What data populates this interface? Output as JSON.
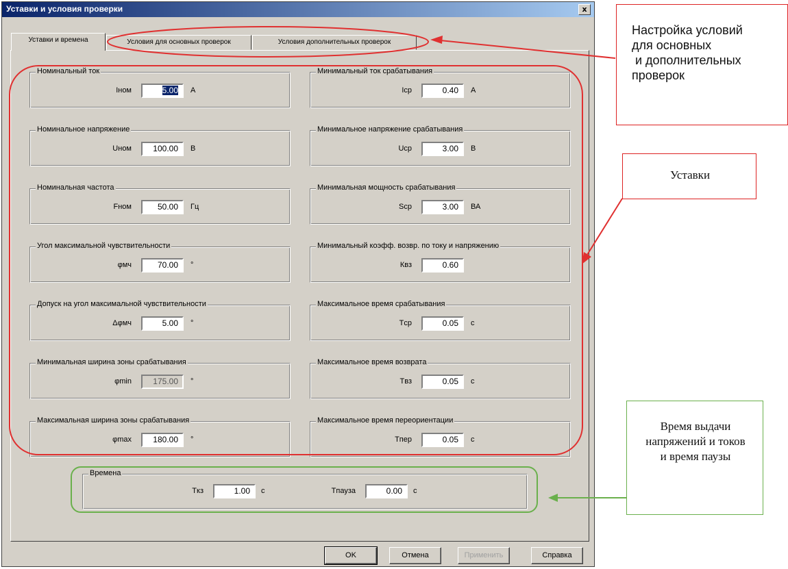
{
  "dialog": {
    "title": "Уставки и условия проверки",
    "close_label": "x",
    "tabs": [
      {
        "label": "Уставки и времена",
        "active": true
      },
      {
        "label": "Условия для основных проверок",
        "active": false
      },
      {
        "label": "Условия дополнительных проверок",
        "active": false
      }
    ],
    "left_groups": [
      {
        "title": "Номинальный ток",
        "label": "Iном",
        "value": "5.00",
        "unit": "А"
      },
      {
        "title": "Номинальное напряжение",
        "label": "Uном",
        "value": "100.00",
        "unit": "В"
      },
      {
        "title": "Номинальная частота",
        "label": "Fном",
        "value": "50.00",
        "unit": "Гц"
      },
      {
        "title": "Угол максимальной чувствительности",
        "label": "φмч",
        "value": "70.00",
        "unit": "°"
      },
      {
        "title": "Допуск на угол максимальной чувствительности",
        "label": "Δφмч",
        "value": "5.00",
        "unit": "°"
      },
      {
        "title": "Минимальная ширина зоны срабатывания",
        "label": "φmin",
        "value": "175.00",
        "unit": "°"
      },
      {
        "title": "Максимальная ширина зоны срабатывания",
        "label": "φmax",
        "value": "180.00",
        "unit": "°"
      }
    ],
    "right_groups": [
      {
        "title": "Минимальный ток срабатывания",
        "label": "Iср",
        "value": "0.40",
        "unit": "А"
      },
      {
        "title": "Минимальное напряжение срабатывания",
        "label": "Uср",
        "value": "3.00",
        "unit": "В"
      },
      {
        "title": "Минимальная мощность срабатывания",
        "label": "Sср",
        "value": "3.00",
        "unit": "ВА"
      },
      {
        "title": "Минимальный коэфф. возвр. по току и напряжению",
        "label": "Квз",
        "value": "0.60",
        "unit": ""
      },
      {
        "title": "Максимальное время срабатывания",
        "label": "Tср",
        "value": "0.05",
        "unit": "с"
      },
      {
        "title": "Максимальное время возврата",
        "label": "Tвз",
        "value": "0.05",
        "unit": "с"
      },
      {
        "title": "Максимальное время переориентации",
        "label": "Tпер",
        "value": "0.05",
        "unit": "с"
      }
    ],
    "times_group": {
      "title": "Времена",
      "fields": [
        {
          "label": "Tкз",
          "value": "1.00",
          "unit": "с"
        },
        {
          "label": "Tпауза",
          "value": "0.00",
          "unit": "с"
        }
      ]
    },
    "buttons": {
      "ok": "OK",
      "cancel": "Отмена",
      "apply": "Применить",
      "help": "Справка"
    }
  },
  "annotations": {
    "tabs_note": "Настройка условий\nдля основных\n и дополнительных\nпроверок",
    "setpoints_note": "Уставки",
    "times_note": "Время выдачи напряжений и токов и время паузы"
  },
  "colors": {
    "red_outline": "#e03030",
    "green_outline": "#6ab04c",
    "dialog_face": "#d4d0c8",
    "titlebar": "#0a246a"
  }
}
